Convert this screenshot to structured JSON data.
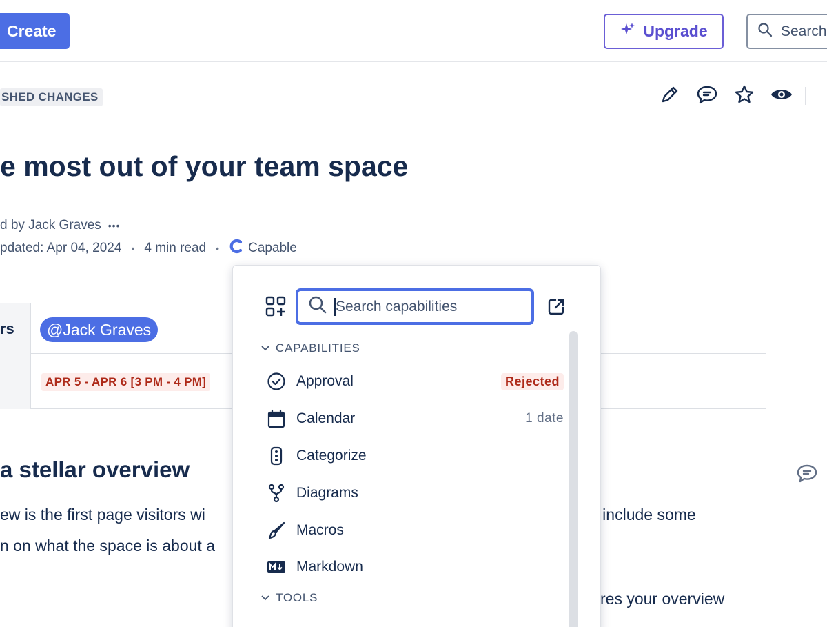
{
  "topbar": {
    "create_label": "Create",
    "upgrade_label": "Upgrade",
    "search_placeholder": "Search"
  },
  "page": {
    "status_lozenge": "SHED CHANGES",
    "title": "e most out of your team space",
    "byline": "d by Jack Graves",
    "byline_more": "•••",
    "updated": "pdated: Apr 04, 2024",
    "read_time": "4 min read",
    "app_name": "Capable",
    "table": {
      "row1_header": "rs",
      "mention": "@Jack Graves",
      "date_range": "APR 5 - APR 6 [3 PM - 4 PM]"
    },
    "heading": "a stellar overview",
    "para_line1_left": "ew is the first page visitors wi",
    "para_line1_right": "o include some",
    "para_line2_left": "n on what the space is about a",
    "para_line3_right": "res your overview"
  },
  "popup": {
    "search_placeholder": "Search capabilities",
    "capabilities_section": "CAPABILITIES",
    "tools_section": "TOOLS",
    "items": [
      {
        "label": "Approval",
        "status": "Rejected",
        "icon": "check-circle-icon"
      },
      {
        "label": "Calendar",
        "meta": "1 date",
        "icon": "calendar-icon"
      },
      {
        "label": "Categorize",
        "icon": "traffic-light-icon"
      },
      {
        "label": "Diagrams",
        "icon": "branch-icon"
      },
      {
        "label": "Macros",
        "icon": "brush-icon"
      },
      {
        "label": "Markdown",
        "icon": "markdown-icon"
      }
    ]
  },
  "colors": {
    "brand_blue": "#4c6ee4",
    "upgrade_purple": "#5a4fd0",
    "danger_text": "#ae2a19",
    "danger_bg": "#fdecea",
    "text": "#172b4d"
  }
}
